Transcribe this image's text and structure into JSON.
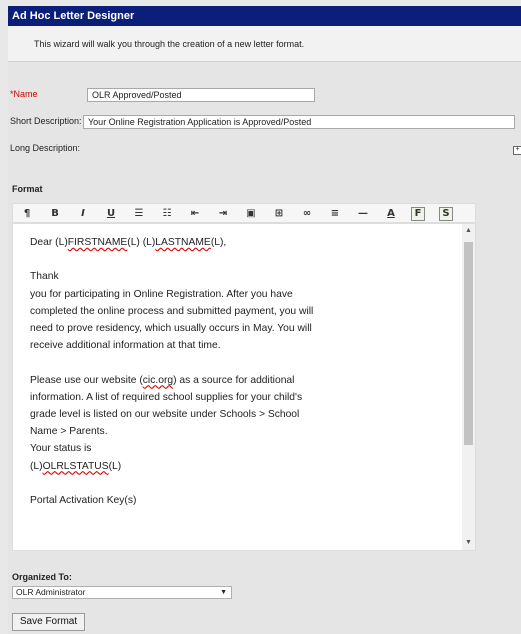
{
  "window": {
    "title": "Ad Hoc Letter Designer"
  },
  "intro": "This wizard will walk you through the creation of a new letter format.",
  "form": {
    "name_label": "*Name",
    "name_value": "OLR Approved/Posted",
    "short_desc_label": "Short Description:",
    "short_desc_value": "Your Online Registration Application is Approved/Posted",
    "long_desc_label": "Long Description:",
    "expand_symbol": "+"
  },
  "format": {
    "label": "Format",
    "toolbar_icons": [
      {
        "name": "paragraph-icon",
        "glyph": "¶"
      },
      {
        "name": "bold-icon",
        "glyph": "B"
      },
      {
        "name": "italic-icon",
        "glyph": "I"
      },
      {
        "name": "underline-icon",
        "glyph": "U"
      },
      {
        "name": "bullet-list-icon",
        "glyph": "☰"
      },
      {
        "name": "numbered-list-icon",
        "glyph": "☷"
      },
      {
        "name": "outdent-icon",
        "glyph": "⇤"
      },
      {
        "name": "indent-icon",
        "glyph": "⇥"
      },
      {
        "name": "image-icon",
        "glyph": "▣"
      },
      {
        "name": "table-icon",
        "glyph": "⊞"
      },
      {
        "name": "link-icon",
        "glyph": "∞"
      },
      {
        "name": "align-icon",
        "glyph": "≡"
      },
      {
        "name": "horizontal-rule-icon",
        "glyph": "—"
      },
      {
        "name": "font-color-icon",
        "glyph": "A"
      },
      {
        "name": "field-insert-icon",
        "glyph": "F"
      },
      {
        "name": "special-insert-icon",
        "glyph": "S"
      }
    ]
  },
  "editor": {
    "greeting_prefix": "Dear  (L)",
    "greeting_field1": "FIRSTNAME",
    "greeting_mid": "(L) (L)",
    "greeting_field2": "LASTNAME",
    "greeting_suffix": "(L),",
    "thank": "Thank",
    "para1": [
      "you for participating in Online Registration. After you have",
      "completed the online process and submitted payment, you will",
      "need to prove residency, which usually occurs in May. You will",
      "receive additional information at that time."
    ],
    "para2_prefix": "Please use our website (",
    "para2_site": "cic.org",
    "para2_suffix": ") as a source for additional",
    "para2": [
      "information. A list of required school supplies for your child's",
      "grade level is listed on our website under Schools > School",
      "Name > Parents."
    ],
    "status_line": "Your status is",
    "status_prefix": "(L)",
    "status_field": "OLRLSTATUS",
    "status_suffix": "(L)",
    "portal": "Portal Activation Key(s)"
  },
  "organized": {
    "label": "Organized To:",
    "selected": "OLR Administrator"
  },
  "save_button": "Save Format"
}
